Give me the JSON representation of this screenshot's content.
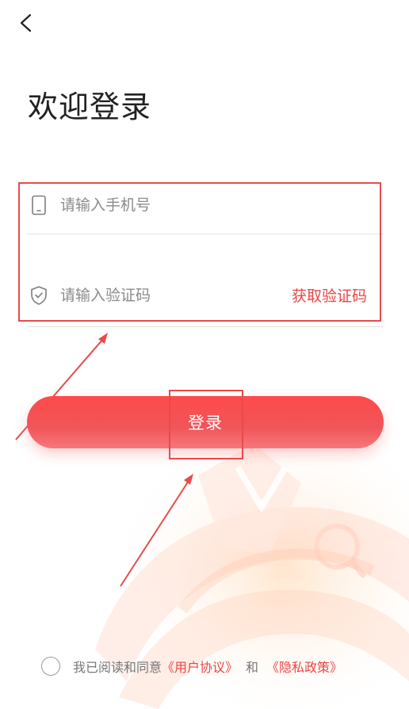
{
  "header": {
    "back_icon": "chevron-left-icon"
  },
  "title": "欢迎登录",
  "phone": {
    "placeholder": "请输入手机号",
    "icon": "phone-icon"
  },
  "code": {
    "placeholder": "请输入验证码",
    "icon": "shield-check-icon",
    "get_code_label": "获取验证码"
  },
  "login_label": "登录",
  "agreement": {
    "prefix": "我已阅读和同意",
    "user_agreement": "《用户协议》",
    "and": "和",
    "privacy_policy": "《隐私政策》"
  },
  "colors": {
    "accent": "#e94545",
    "button_top": "#ff4a4a",
    "annotation": "#e84b4b"
  }
}
